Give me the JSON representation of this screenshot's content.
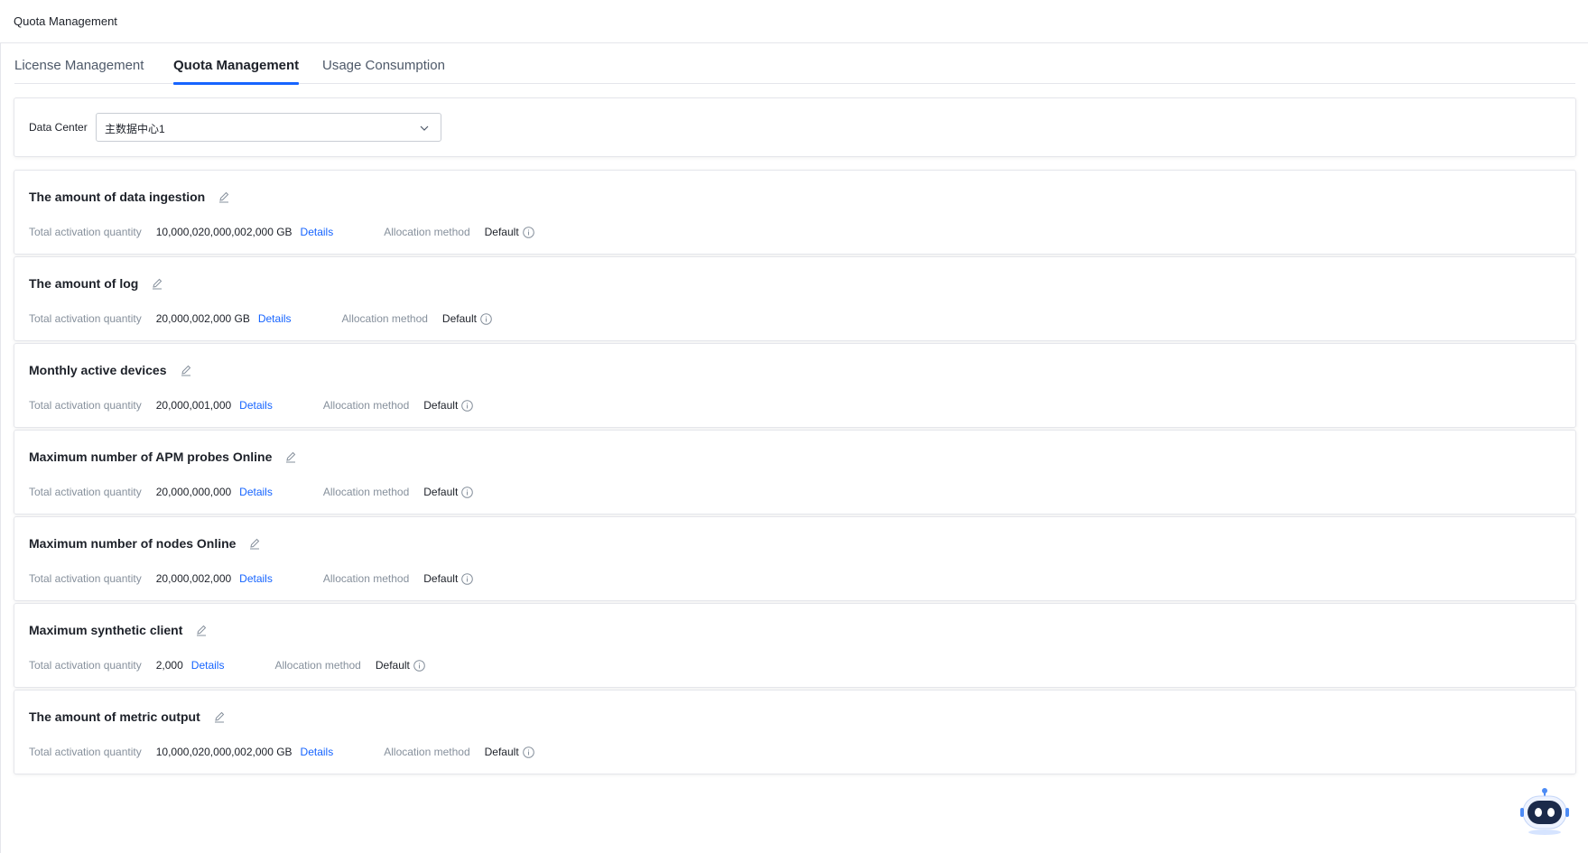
{
  "header": {
    "title": "Quota Management"
  },
  "tabs": [
    {
      "label": "License Management",
      "active": false
    },
    {
      "label": "Quota Management",
      "active": true
    },
    {
      "label": "Usage Consumption",
      "active": false
    }
  ],
  "filter": {
    "label": "Data Center",
    "selected": "主数据中心1"
  },
  "common": {
    "total_label": "Total activation quantity",
    "details_label": "Details",
    "allocation_label": "Allocation method"
  },
  "quotas": [
    {
      "title": "The amount of data ingestion",
      "value": "10,000,020,000,002,000 GB",
      "allocation": "Default"
    },
    {
      "title": "The amount of log",
      "value": "20,000,002,000 GB",
      "allocation": "Default"
    },
    {
      "title": "Monthly active devices",
      "value": "20,000,001,000",
      "allocation": "Default"
    },
    {
      "title": "Maximum number of APM probes Online",
      "value": "20,000,000,000",
      "allocation": "Default"
    },
    {
      "title": "Maximum number of nodes Online",
      "value": "20,000,002,000",
      "allocation": "Default"
    },
    {
      "title": "Maximum synthetic client",
      "value": "2,000",
      "allocation": "Default"
    },
    {
      "title": "The amount of metric output",
      "value": "10,000,020,000,002,000 GB",
      "allocation": "Default"
    }
  ],
  "colors": {
    "accent": "#1664ff",
    "text": "#1d2129",
    "muted": "#86909c"
  }
}
